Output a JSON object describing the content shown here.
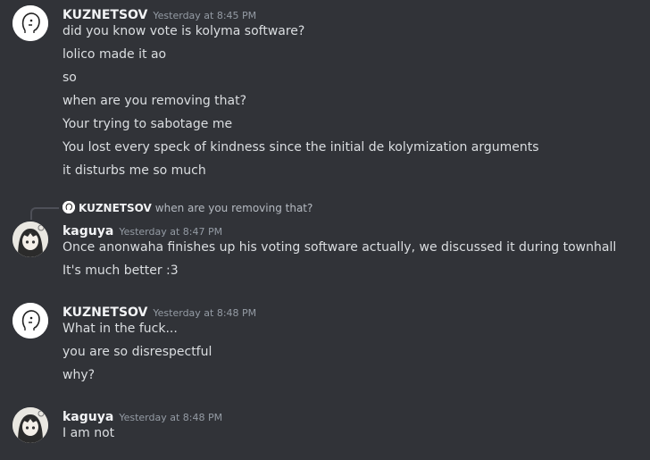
{
  "messages": [
    {
      "author": "KUZNETSOV",
      "timestamp": "Yesterday at 8:45 PM",
      "avatar_icon": "doodle-face-icon",
      "lines": [
        "did you know vote is kolyma software?",
        "lolico made it ao",
        "so",
        "when are you removing that?",
        "Your trying to sabotage me",
        "You lost every speck of kindness since the initial de kolymization arguments",
        "it disturbs me so much"
      ]
    },
    {
      "reply_to": {
        "author": "KUZNETSOV",
        "text": "when are you removing that?"
      },
      "author": "kaguya",
      "timestamp": "Yesterday at 8:47 PM",
      "avatar_icon": "anime-girl-avatar-icon",
      "lines": [
        "Once anonwaha finishes up his voting software actually, we discussed it during townhall",
        "It's much better :3"
      ]
    },
    {
      "author": "KUZNETSOV",
      "timestamp": "Yesterday at 8:48 PM",
      "avatar_icon": "doodle-face-icon",
      "lines": [
        "What in the fuck...",
        "you are so disrespectful",
        "why?"
      ]
    },
    {
      "author": "kaguya",
      "timestamp": "Yesterday at 8:48 PM",
      "avatar_icon": "anime-girl-avatar-icon",
      "lines": [
        "I am not"
      ]
    }
  ],
  "colors": {
    "background": "#313338",
    "username": "#f2f3f5",
    "timestamp": "#949ba4",
    "message_text": "#dbdee1"
  }
}
